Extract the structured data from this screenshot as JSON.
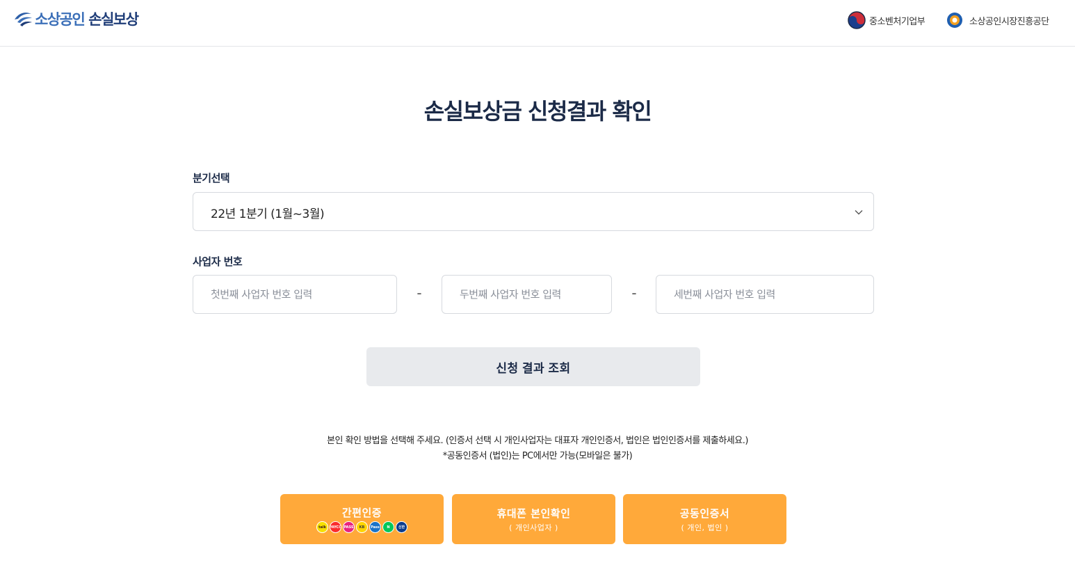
{
  "header": {
    "logo_part1": "소상공인",
    "logo_part2": "손실보상",
    "ministry": "중소벤처기업부",
    "agency": "소상공인시장진흥공단"
  },
  "main": {
    "title": "손실보상금 신청결과 확인",
    "quarter_label": "분기선택",
    "quarter_value": "22년 1분기 (1월~3월)",
    "bizno_label": "사업자 번호",
    "bizno_placeholder_1": "첫번째 사업자 번호 입력",
    "bizno_placeholder_2": "두번째 사업자 번호 입력",
    "bizno_placeholder_3": "세번째 사업자 번호 입력",
    "dash": "-",
    "query_button": "신청 결과 조회",
    "notice_line1": "본인 확인 방법을 선택해 주세요. (인증서 선택 시 개인사업자는 대표자 개인인증서, 법인은 법인인증서를 제출하세요.)",
    "notice_line2": "*공동인증서 (법인)는 PC에서만 가능(모바일은 불가)"
  },
  "auth": {
    "simple_label": "간편인증",
    "simple_icons": [
      {
        "name": "kakao-icon",
        "text": "talk",
        "color": "#f7e000",
        "fg": "#3a1d1d"
      },
      {
        "name": "payco-icon",
        "text": "PAYCO",
        "color": "#fa2d2d",
        "fg": "#ffffff"
      },
      {
        "name": "pass-icon",
        "text": "PASS",
        "color": "#e8237f",
        "fg": "#ffffff"
      },
      {
        "name": "kb-icon",
        "text": "KB",
        "color": "#ffd500",
        "fg": "#3a3a3a"
      },
      {
        "name": "samsungpass-icon",
        "text": "Pass",
        "color": "#1a73c8",
        "fg": "#ffffff"
      },
      {
        "name": "naver-icon",
        "text": "N",
        "color": "#03c75a",
        "fg": "#ffffff"
      },
      {
        "name": "shinhan-icon",
        "text": "신한",
        "color": "#0b3b8c",
        "fg": "#ffffff"
      }
    ],
    "phone_label": "휴대폰 본인확인",
    "phone_sub": "( 개인사업자 )",
    "cert_label": "공동인증서",
    "cert_sub": "( 개인, 법인 )"
  }
}
